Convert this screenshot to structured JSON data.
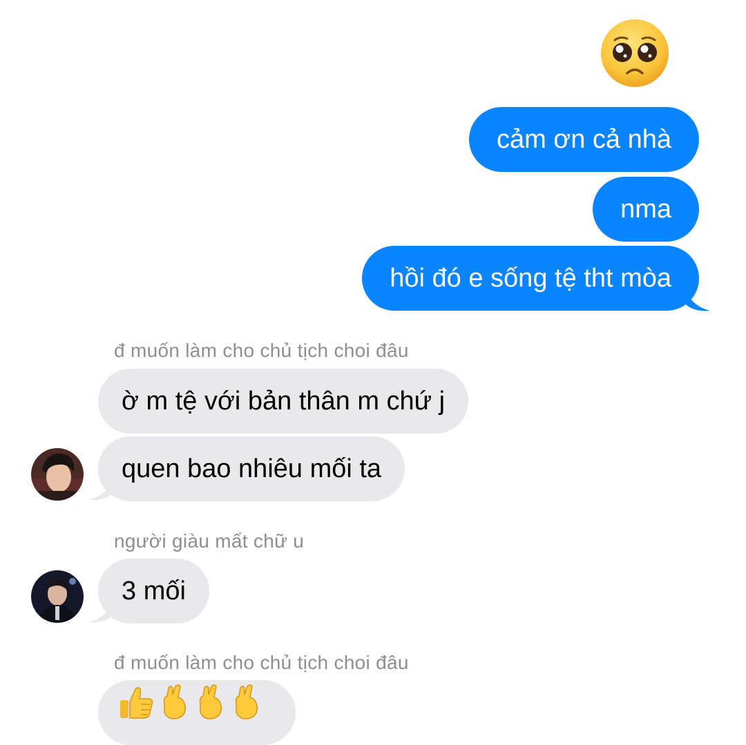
{
  "thread": {
    "reaction_emoji": "pleading-face-icon",
    "outgoing": [
      {
        "text": "cảm ơn cả nhà"
      },
      {
        "text": "nma"
      },
      {
        "text": "hồi đó e sống tệ tht mòa"
      }
    ],
    "groups": [
      {
        "sender": "đ muốn làm cho chủ tịch choi đâu",
        "messages": [
          {
            "text": "ờ m tệ với bản thân m chứ j"
          },
          {
            "text": "quen bao nhiêu mối ta"
          }
        ],
        "avatar": "avatar-dark-hair"
      },
      {
        "sender": "người giàu mất chữ u",
        "messages": [
          {
            "text": "3 mối"
          }
        ],
        "avatar": "avatar-suit"
      },
      {
        "sender": "đ muốn làm cho chủ tịch choi đâu",
        "messages": [
          {
            "emojis": [
              "thumbs-up-icon",
              "crossed-fingers-icon",
              "crossed-fingers-icon",
              "crossed-fingers-icon"
            ]
          }
        ]
      }
    ]
  },
  "colors": {
    "outgoing_bubble": "#0a84ff",
    "incoming_bubble": "#e9e9eb",
    "sender_name": "#8e8e93",
    "emoji_yellow": "#f7c531"
  }
}
